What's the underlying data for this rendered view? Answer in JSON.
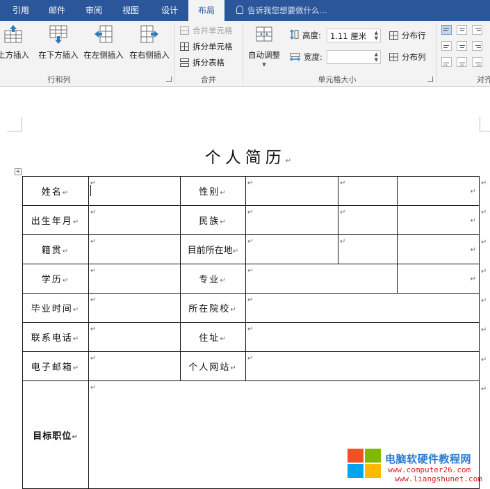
{
  "tabs": [
    {
      "label": "引用",
      "active": false
    },
    {
      "label": "邮件",
      "active": false
    },
    {
      "label": "审阅",
      "active": false
    },
    {
      "label": "视图",
      "active": false
    },
    {
      "label": "设计",
      "active": false
    },
    {
      "label": "布局",
      "active": true
    }
  ],
  "tell_me": "告诉我您想要做什么...",
  "ribbon": {
    "rows_cols": {
      "insert_above": "上方插入",
      "insert_below": "在下方插入",
      "insert_left": "在左侧插入",
      "insert_right": "在右侧插入",
      "group_label": "行和列"
    },
    "merge": {
      "merge_cells": "合并单元格",
      "split_cells": "拆分单元格",
      "split_table": "拆分表格",
      "group_label": "合并"
    },
    "cell_size": {
      "autofit": "自动调整",
      "height_label": "高度:",
      "height_value": "1.11 厘米",
      "width_label": "宽度:",
      "width_value": "",
      "distribute_rows": "分布行",
      "distribute_cols": "分布列",
      "group_label": "单元格大小"
    },
    "alignment": {
      "group_label": "对齐"
    }
  },
  "document": {
    "title": "个人简历",
    "para_mark": "↵",
    "rows": [
      {
        "label": "姓名",
        "field": "性别"
      },
      {
        "label": "出生年月",
        "field": "民族"
      },
      {
        "label": "籍贯",
        "field": "目前所在地"
      },
      {
        "label": "学历",
        "field": "专业"
      },
      {
        "label": "毕业时间",
        "field": "所在院校"
      },
      {
        "label": "联系电话",
        "field": "住址"
      },
      {
        "label": "电子邮箱",
        "field": "个人网站"
      },
      {
        "label": "目标职位",
        "field": ""
      }
    ]
  },
  "watermark": {
    "name": "电脑软硬件教程网",
    "url1": "www.computer26.com",
    "url2": "www.liangshunet.com"
  },
  "colors": {
    "ribbon_blue": "#2b579a",
    "ribbon_bg": "#f3f3f3"
  }
}
